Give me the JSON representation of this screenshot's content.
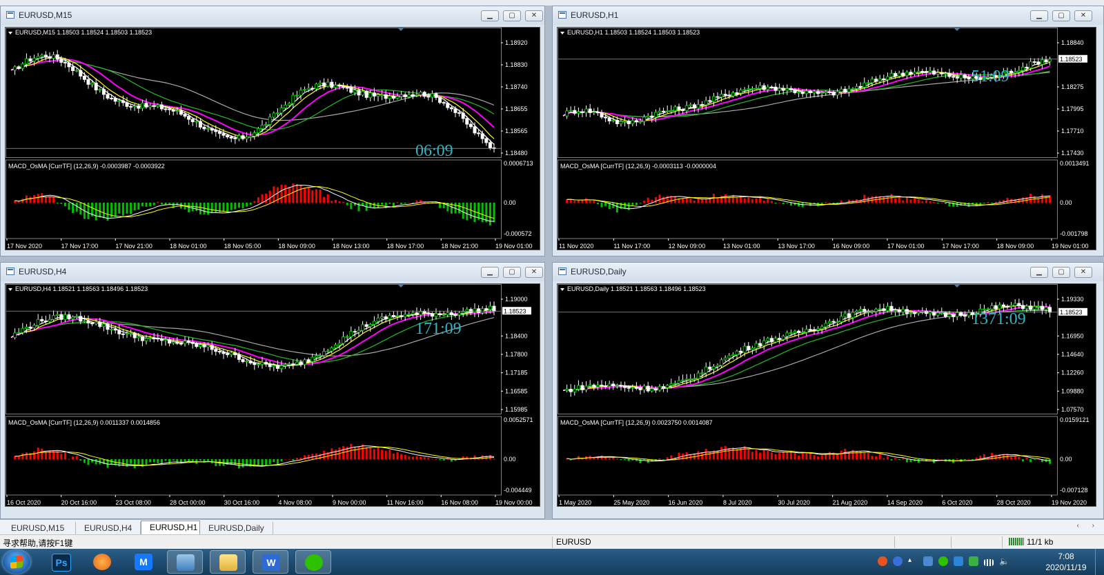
{
  "windows": [
    {
      "id": "m15",
      "title": "EURUSD,M15",
      "ohlc_label": "EURUSD,M15  1.18503 1.18524 1.18503 1.18523",
      "price_levels": [
        "1.18920",
        "1.18830",
        "1.18740",
        "1.18655",
        "1.18565",
        "1.18480"
      ],
      "current_price": "1.18523",
      "timer": "06:09",
      "macd_label": "MACD_OsMA [CurrTF] (12,26,9) -0.0003987 -0.0003922",
      "macd_levels": [
        "0.0006713",
        "0.00",
        "-0.000572"
      ],
      "time_labels": [
        "17 Nov 2020",
        "17 Nov 17:00",
        "17 Nov 21:00",
        "18 Nov 01:00",
        "18 Nov 05:00",
        "18 Nov 09:00",
        "18 Nov 13:00",
        "18 Nov 17:00",
        "18 Nov 21:00",
        "19 Nov 01:00"
      ]
    },
    {
      "id": "h1",
      "title": "EURUSD,H1",
      "ohlc_label": "EURUSD,H1  1.18503 1.18524 1.18503 1.18523",
      "price_levels": [
        "1.18840",
        "1.18523",
        "1.18275",
        "1.17995",
        "1.17710",
        "1.17430"
      ],
      "current_price": "1.18523",
      "timer": "51:09",
      "macd_label": "MACD_OsMA [CurrTF] (12,26,9) -0.0003113 -0.0000004",
      "macd_levels": [
        "0.0013491",
        "0.00",
        "-0.001798"
      ],
      "time_labels": [
        "11 Nov 2020",
        "11 Nov 17:00",
        "12 Nov 09:00",
        "13 Nov 01:00",
        "13 Nov 17:00",
        "16 Nov 09:00",
        "17 Nov 01:00",
        "17 Nov 17:00",
        "18 Nov 09:00",
        "19 Nov 01:00"
      ]
    },
    {
      "id": "h4",
      "title": "EURUSD,H4",
      "ohlc_label": "EURUSD,H4  1.18521 1.18563 1.18496 1.18523",
      "price_levels": [
        "1.19000",
        "1.18523",
        "1.18400",
        "1.17800",
        "1.17185",
        "1.16585",
        "1.15985"
      ],
      "current_price": "1.18523",
      "timer": "171:09",
      "macd_label": "MACD_OsMA [CurrTF] (12,26,9) 0.0011337 0.0014856",
      "macd_levels": [
        "0.0052571",
        "0.00",
        "-0.004449"
      ],
      "time_labels": [
        "16 Oct 2020",
        "20 Oct 16:00",
        "23 Oct 08:00",
        "28 Oct 00:00",
        "30 Oct 16:00",
        "4 Nov 08:00",
        "9 Nov 00:00",
        "11 Nov 16:00",
        "16 Nov 08:00",
        "19 Nov 00:00"
      ]
    },
    {
      "id": "d1",
      "title": "EURUSD,Daily",
      "ohlc_label": "EURUSD,Daily  1.18521 1.18563 1.18496 1.18523",
      "price_levels": [
        "1.19330",
        "1.18523",
        "1.16950",
        "1.14640",
        "1.12260",
        "1.09880",
        "1.07570"
      ],
      "current_price": "1.18523",
      "timer": "1371:09",
      "macd_label": "MACD_OsMA [CurrTF] (12,26,9) 0.0023750 0.0014087",
      "macd_levels": [
        "0.0159121",
        "0.00",
        "-0.007128"
      ],
      "time_labels": [
        "1 May 2020",
        "25 May 2020",
        "16 Jun 2020",
        "8 Jul 2020",
        "30 Jul 2020",
        "21 Aug 2020",
        "14 Sep 2020",
        "6 Oct 2020",
        "28 Oct 2020",
        "19 Nov 2020"
      ]
    }
  ],
  "tabs": [
    {
      "label": "EURUSD,M15",
      "active": false
    },
    {
      "label": "EURUSD,H4",
      "active": false
    },
    {
      "label": "EURUSD,H1",
      "active": true
    },
    {
      "label": "EURUSD,Daily",
      "active": false
    }
  ],
  "status": {
    "help": "寻求帮助,请按F1键",
    "symbol": "EURUSD",
    "connection": "11/1 kb"
  },
  "taskbar": {
    "apps": [
      "start-button",
      "photoshop",
      "browser",
      "app-m",
      "remote-desktop",
      "file-explorer",
      "wps",
      "wechat"
    ],
    "time": "7:08",
    "date": "2020/11/19"
  },
  "colors": {
    "bull": "#00c000",
    "bear": "#ff0000",
    "ma_white": "#ffffff",
    "ma_yellow": "#ffff00",
    "ma_magenta": "#ff00ff",
    "ma_green": "#22bb22",
    "ma_gray": "#a8a8a8",
    "timer": "#2fb5c5"
  }
}
